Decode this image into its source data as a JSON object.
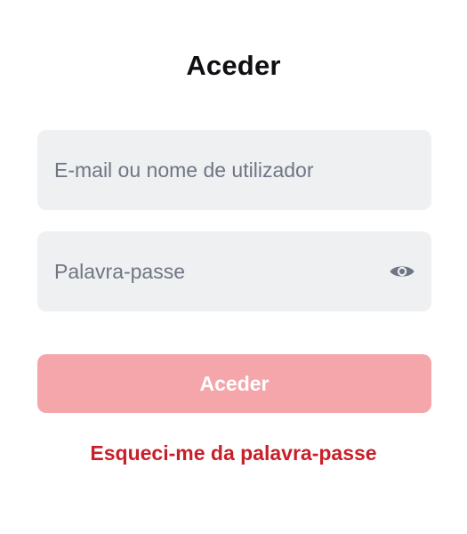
{
  "page": {
    "title": "Aceder"
  },
  "form": {
    "email_placeholder": "E-mail ou nome de utilizador",
    "email_value": "",
    "password_placeholder": "Palavra-passe",
    "password_value": "",
    "password_toggle_icon": "eye-icon",
    "submit_label": "Aceder",
    "forgot_label": "Esqueci-me da palavra-passe"
  },
  "colors": {
    "field_background": "#eef0f2",
    "placeholder": "#6f7683",
    "button_disabled": "#f5a6aa",
    "link_red": "#c8202a"
  }
}
